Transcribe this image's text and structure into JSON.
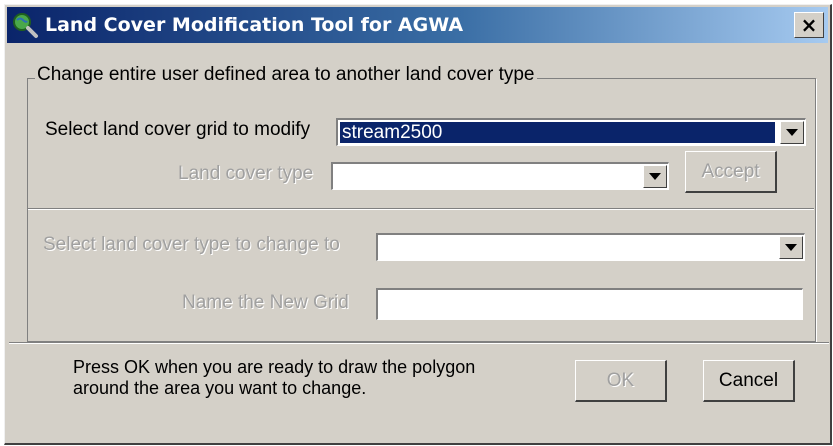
{
  "window": {
    "title": "Land Cover Modification Tool for AGWA",
    "close_glyph": "×"
  },
  "frame": {
    "legend": "Change entire user defined area to another land cover type"
  },
  "grid_select": {
    "label": "Select land cover grid to modify",
    "value": "stream2500"
  },
  "land_cover_type": {
    "label": "Land cover type",
    "value": ""
  },
  "accept_button": {
    "label": "Accept"
  },
  "change_to": {
    "label": "Select land cover type to change to",
    "value": ""
  },
  "new_grid": {
    "label": "Name the New Grid",
    "value": ""
  },
  "message": {
    "line1": "Press OK when you are ready to draw the polygon",
    "line2": "around the area you want to change."
  },
  "ok_button": {
    "label": "OK"
  },
  "cancel_button": {
    "label": "Cancel"
  },
  "colors": {
    "titlebar_start": "#0a246a",
    "titlebar_end": "#a6caf0",
    "face": "#d4d0c8",
    "selection": "#0a246a"
  },
  "icons": {
    "app": "magnifier-globe-icon",
    "close": "close-icon",
    "dropdown": "chevron-down-icon"
  }
}
